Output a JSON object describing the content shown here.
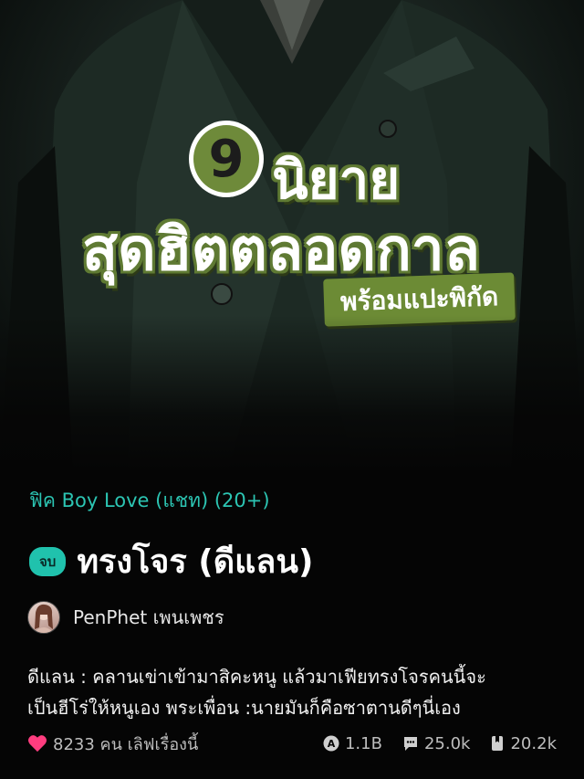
{
  "cover": {
    "badge_number": "9",
    "headline_line1": "นิยาย",
    "headline_line2": "สุดฮิตตลอดกาล",
    "tag_banner": "พร้อมแปะพิกัด"
  },
  "story": {
    "genre": "ฟิค Boy Love (แชท) (20+)",
    "status": "จบ",
    "title": "ทรงโจร (ดีแลน)",
    "author": "PenPhet เพนเพชร",
    "description_line1": "ดีแลน : คลานเข่าเข้ามาสิคะหนู แล้วมาเฟียทรงโจรคนนี้จะ",
    "description_line2": "เป็นฮีโร่ให้หนูเอง  พระเพื่อน :นายมันก็คือซาตานดีๆนี่เอง"
  },
  "stats": {
    "likes": "8233 คน เลิฟเรื่องนี้",
    "views": "1.1B",
    "comments": "25.0k",
    "bookmarks": "20.2k"
  },
  "colors": {
    "accent_teal": "#20c2ad",
    "heart_pink": "#ff3d7f",
    "olive": "#6c8b35"
  },
  "icons": [
    "heart-icon",
    "views-icon",
    "comment-icon",
    "bookmark-icon"
  ]
}
